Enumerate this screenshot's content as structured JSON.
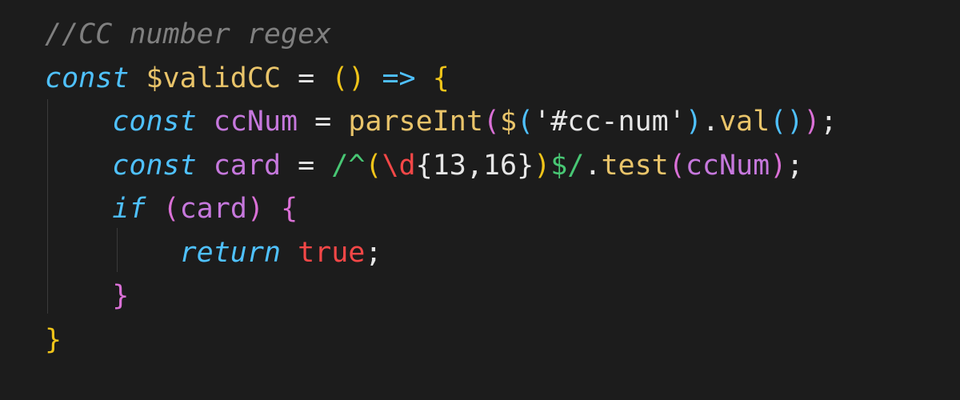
{
  "editor": {
    "colors": {
      "background": "#1c1c1c",
      "comment": "#7f7f7f",
      "keyword": "#4fc1ff",
      "function": "#e9c46a",
      "variable": "#c678dd",
      "bracket_gold": "#f0c419",
      "bracket_purple": "#da70d6",
      "bracket_blue": "#4fc1ff",
      "boolean": "#f44747",
      "regex": "#48c774",
      "plain": "#e6e6e6"
    },
    "lines": [
      [
        {
          "text": "//CC number regex",
          "cls": "comment"
        }
      ],
      [
        {
          "text": "const",
          "cls": "kw-it"
        },
        {
          "text": " ",
          "cls": "plain"
        },
        {
          "text": "$validCC",
          "cls": "ident-fn"
        },
        {
          "text": " = ",
          "cls": "plain"
        },
        {
          "text": "()",
          "color": "#f0c419"
        },
        {
          "text": " ",
          "cls": "plain"
        },
        {
          "text": "=>",
          "color": "#4fc1ff"
        },
        {
          "text": " ",
          "cls": "plain"
        },
        {
          "text": "{",
          "color": "#f0c419"
        }
      ],
      [
        {
          "text": "    ",
          "cls": "plain"
        },
        {
          "text": "const",
          "cls": "kw-it"
        },
        {
          "text": " ",
          "cls": "plain"
        },
        {
          "text": "ccNum",
          "cls": "ident-var"
        },
        {
          "text": " = ",
          "cls": "plain"
        },
        {
          "text": "parseInt",
          "cls": "ident-fn"
        },
        {
          "text": "(",
          "color": "#da70d6"
        },
        {
          "text": "$",
          "cls": "ident-fn"
        },
        {
          "text": "(",
          "color": "#4fc1ff"
        },
        {
          "text": "'#cc-num'",
          "cls": "plain"
        },
        {
          "text": ")",
          "color": "#4fc1ff"
        },
        {
          "text": ".",
          "cls": "plain"
        },
        {
          "text": "val",
          "cls": "ident-fn"
        },
        {
          "text": "()",
          "color": "#4fc1ff"
        },
        {
          "text": ")",
          "color": "#da70d6"
        },
        {
          "text": ";",
          "cls": "plain"
        }
      ],
      [
        {
          "text": "    ",
          "cls": "plain"
        },
        {
          "text": "const",
          "cls": "kw-it"
        },
        {
          "text": " ",
          "cls": "plain"
        },
        {
          "text": "card",
          "cls": "ident-var"
        },
        {
          "text": " = ",
          "cls": "plain"
        },
        {
          "text": "/^",
          "cls": "regex"
        },
        {
          "text": "(",
          "color": "#f0c419"
        },
        {
          "text": "\\d",
          "cls": "regex-red"
        },
        {
          "text": "{13,16}",
          "cls": "plain"
        },
        {
          "text": ")",
          "color": "#f0c419"
        },
        {
          "text": "$/",
          "cls": "regex"
        },
        {
          "text": ".",
          "cls": "plain"
        },
        {
          "text": "test",
          "cls": "ident-fn"
        },
        {
          "text": "(",
          "color": "#da70d6"
        },
        {
          "text": "ccNum",
          "cls": "ident-var"
        },
        {
          "text": ")",
          "color": "#da70d6"
        },
        {
          "text": ";",
          "cls": "plain"
        }
      ],
      [
        {
          "text": "    ",
          "cls": "plain"
        },
        {
          "text": "if",
          "cls": "kw-it"
        },
        {
          "text": " ",
          "cls": "plain"
        },
        {
          "text": "(",
          "color": "#da70d6"
        },
        {
          "text": "card",
          "cls": "ident-var"
        },
        {
          "text": ")",
          "color": "#da70d6"
        },
        {
          "text": " ",
          "cls": "plain"
        },
        {
          "text": "{",
          "color": "#da70d6"
        }
      ],
      [
        {
          "text": "        ",
          "cls": "plain"
        },
        {
          "text": "return",
          "cls": "kw-it"
        },
        {
          "text": " ",
          "cls": "plain"
        },
        {
          "text": "true",
          "cls": "bool"
        },
        {
          "text": ";",
          "cls": "plain"
        }
      ],
      [
        {
          "text": "    ",
          "cls": "plain"
        },
        {
          "text": "}",
          "color": "#da70d6"
        }
      ],
      [
        {
          "text": "}",
          "color": "#f0c419"
        }
      ]
    ]
  }
}
